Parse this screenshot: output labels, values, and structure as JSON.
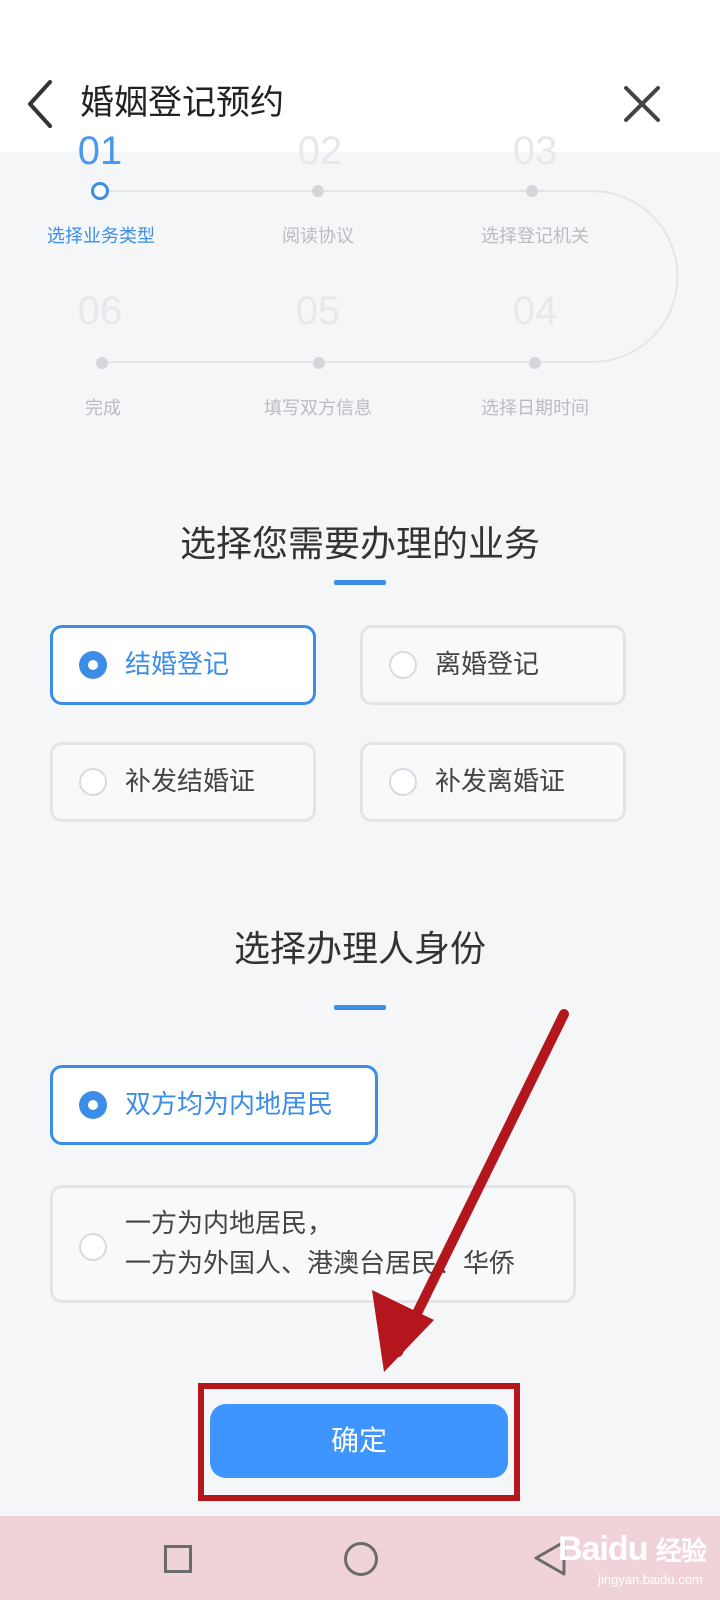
{
  "header": {
    "title": "婚姻登记预约"
  },
  "steps": [
    {
      "num": "01",
      "label": "选择业务类型",
      "active": true
    },
    {
      "num": "02",
      "label": "阅读协议",
      "active": false
    },
    {
      "num": "03",
      "label": "选择登记机关",
      "active": false
    },
    {
      "num": "04",
      "label": "选择日期时间",
      "active": false
    },
    {
      "num": "05",
      "label": "填写双方信息",
      "active": false
    },
    {
      "num": "06",
      "label": "完成",
      "active": false
    }
  ],
  "business": {
    "title": "选择您需要办理的业务",
    "options": [
      {
        "label": "结婚登记",
        "selected": true
      },
      {
        "label": "离婚登记",
        "selected": false
      },
      {
        "label": "补发结婚证",
        "selected": false
      },
      {
        "label": "补发离婚证",
        "selected": false
      }
    ]
  },
  "identity": {
    "title": "选择办理人身份",
    "options": [
      {
        "label": "双方均为内地居民",
        "selected": true
      },
      {
        "label_line1": "一方为内地居民，",
        "label_line2": "一方为外国人、港澳台居民、华侨",
        "selected": false
      }
    ]
  },
  "confirm": {
    "label": "确定"
  },
  "watermark": {
    "logo": "Bai",
    "logo_tail": "经验",
    "sub": "jingyan.baidu.com"
  },
  "colors": {
    "accent": "#3b8de8",
    "button": "#3e95ff",
    "annotation": "#b3161c"
  }
}
